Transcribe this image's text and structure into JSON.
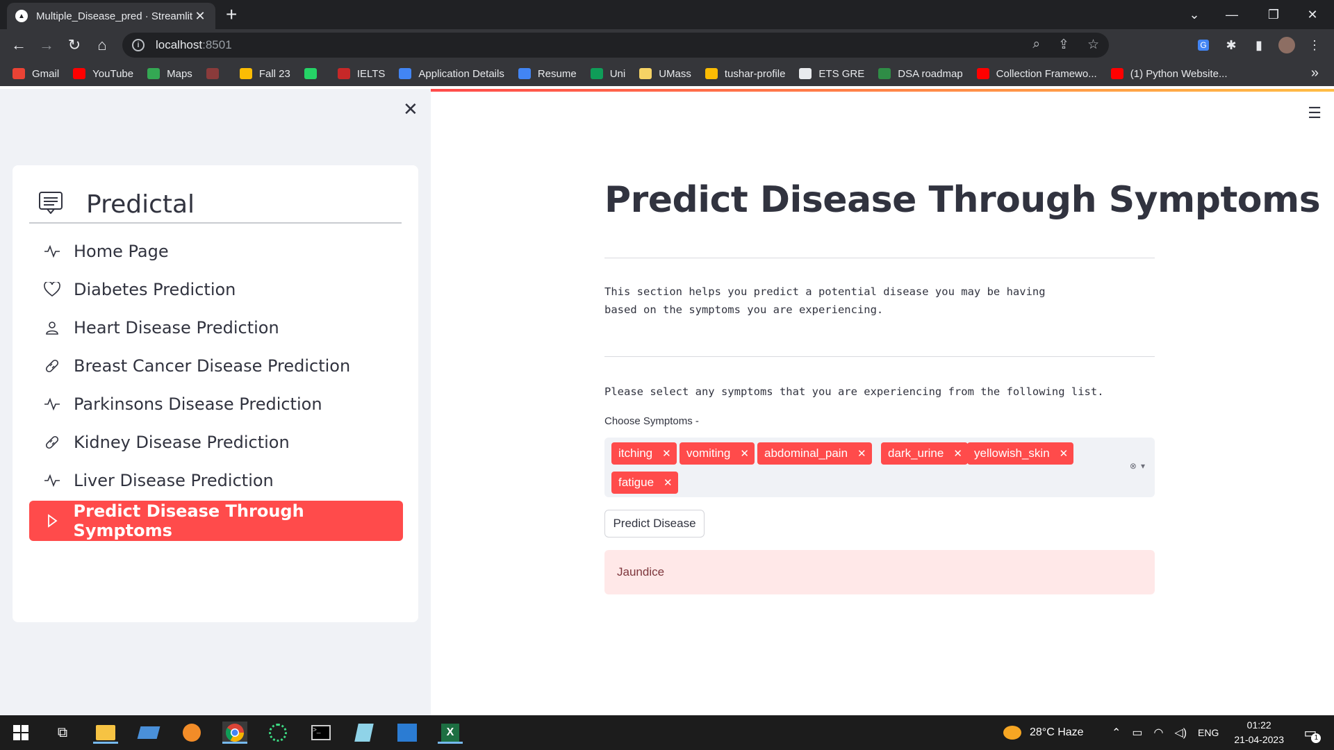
{
  "browser": {
    "tab_title": "Multiple_Disease_pred · Streamlit",
    "url_host": "localhost",
    "url_port": ":8501",
    "bookmarks": [
      {
        "label": "Gmail",
        "color": "#ea4335"
      },
      {
        "label": "YouTube",
        "color": "#ff0000"
      },
      {
        "label": "Maps",
        "color": "#34a853"
      },
      {
        "label": "",
        "color": "#8a3b3b"
      },
      {
        "label": "Fall 23",
        "color": "#fbbc04"
      },
      {
        "label": "",
        "color": "#25d366"
      },
      {
        "label": "IELTS",
        "color": "#c62828"
      },
      {
        "label": "Application Details",
        "color": "#4285f4"
      },
      {
        "label": "Resume",
        "color": "#4285f4"
      },
      {
        "label": "Uni",
        "color": "#0f9d58"
      },
      {
        "label": "UMass",
        "color": "#f6d365"
      },
      {
        "label": "tushar-profile",
        "color": "#fbbc04"
      },
      {
        "label": "ETS GRE",
        "color": "#e8eaed"
      },
      {
        "label": "DSA roadmap",
        "color": "#2f8d46"
      },
      {
        "label": "Collection Framewo...",
        "color": "#ff0000"
      },
      {
        "label": "(1) Python Website...",
        "color": "#ff0000"
      }
    ]
  },
  "sidebar": {
    "title": "Predictal",
    "items": [
      {
        "label": "Home Page",
        "icon": "activity-icon"
      },
      {
        "label": "Diabetes Prediction",
        "icon": "heart-icon"
      },
      {
        "label": "Heart Disease Prediction",
        "icon": "person-icon"
      },
      {
        "label": "Breast Cancer Disease Prediction",
        "icon": "bandaid-icon"
      },
      {
        "label": "Parkinsons Disease Prediction",
        "icon": "activity-icon"
      },
      {
        "label": "Kidney Disease Prediction",
        "icon": "bandaid-icon"
      },
      {
        "label": "Liver Disease Prediction",
        "icon": "activity-icon"
      },
      {
        "label": "Predict Disease Through Symptoms",
        "icon": "play-icon",
        "active": true
      }
    ],
    "accent": "#ff4b4b"
  },
  "main": {
    "title": "Predict Disease Through Symptoms",
    "intro_line1": "This section helps you predict a potential disease you may be having",
    "intro_line2": "based on the symptoms you are experiencing.",
    "instruction": "Please select any symptoms that you are experiencing from the following list.",
    "field_label": "Choose Symptoms -",
    "selected_symptoms": [
      "itching",
      "vomiting",
      "abdominal_pain",
      "dark_urine",
      "yellowish_skin",
      "fatigue"
    ],
    "button_label": "Predict Disease",
    "result": "Jaundice"
  },
  "taskbar": {
    "weather": "28°C  Haze",
    "lang": "ENG",
    "time": "01:22",
    "date": "21-04-2023",
    "notifications": "1"
  }
}
